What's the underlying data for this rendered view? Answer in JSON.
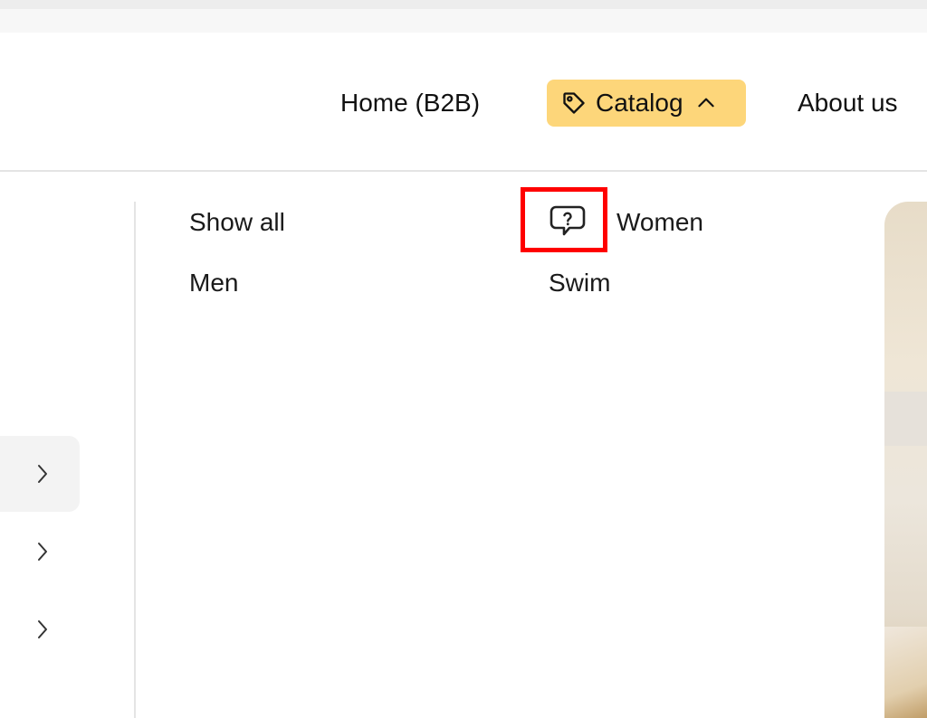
{
  "nav": {
    "home_label": "Home (B2B)",
    "catalog_label": "Catalog",
    "about_label": "About us",
    "catalog_icon": "tag-icon",
    "catalog_chevron_icon": "chevron-up-icon",
    "catalog_accent": "#fdd67a"
  },
  "sidebar": {
    "rows": [
      {
        "icon": "chevron-right-icon",
        "active": true
      },
      {
        "icon": "chevron-right-icon",
        "active": false
      },
      {
        "icon": "chevron-right-icon",
        "active": false
      }
    ]
  },
  "dropdown": {
    "show_all": "Show all",
    "men": "Men",
    "women": "Women",
    "swim": "Swim",
    "women_icon": "help-chat-icon",
    "highlight_color": "#ff0000"
  }
}
